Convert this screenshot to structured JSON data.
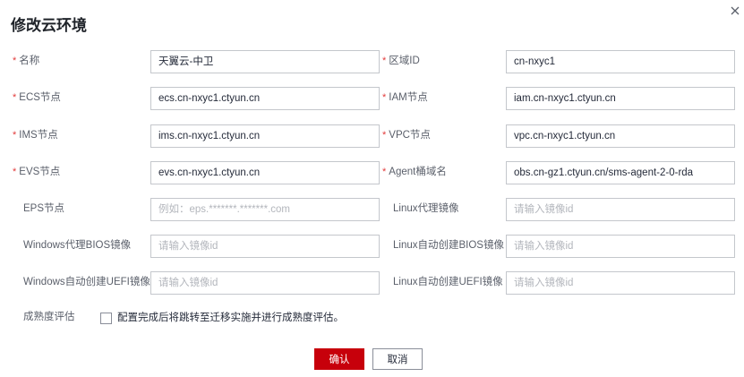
{
  "dialog": {
    "title": "修改云环境",
    "close_icon": "close-icon"
  },
  "form": {
    "required_mark": "*",
    "fields": {
      "name": {
        "label": "名称",
        "value": "天翼云-中卫",
        "required": true
      },
      "region_id": {
        "label": "区域ID",
        "value": "cn-nxyc1",
        "required": true
      },
      "ecs": {
        "label": "ECS节点",
        "value": "ecs.cn-nxyc1.ctyun.cn",
        "required": true
      },
      "iam": {
        "label": "IAM节点",
        "value": "iam.cn-nxyc1.ctyun.cn",
        "required": true
      },
      "ims": {
        "label": "IMS节点",
        "value": "ims.cn-nxyc1.ctyun.cn",
        "required": true
      },
      "vpc": {
        "label": "VPC节点",
        "value": "vpc.cn-nxyc1.ctyun.cn",
        "required": true
      },
      "evs": {
        "label": "EVS节点",
        "value": "evs.cn-nxyc1.ctyun.cn",
        "required": true
      },
      "agent_bucket": {
        "label": "Agent桶域名",
        "value": "obs.cn-gz1.ctyun.cn/sms-agent-2-0-rda",
        "required": true
      },
      "eps": {
        "label": "EPS节点",
        "placeholder": "例如：eps.*******.*******.com",
        "required": false
      },
      "linux_proxy_image": {
        "label": "Linux代理镜像",
        "placeholder": "请输入镜像id",
        "required": false
      },
      "windows_proxy_bios_image": {
        "label": "Windows代理BIOS镜像",
        "placeholder": "请输入镜像id",
        "required": false
      },
      "linux_auto_bios_image": {
        "label": "Linux自动创建BIOS镜像",
        "placeholder": "请输入镜像id",
        "required": false
      },
      "windows_auto_uefi_image": {
        "label": "Windows自动创建UEFI镜像",
        "placeholder": "请输入镜像id",
        "required": false
      },
      "linux_auto_uefi_image": {
        "label": "Linux自动创建UEFI镜像",
        "placeholder": "请输入镜像id",
        "required": false
      }
    },
    "maturity": {
      "label": "成熟度评估",
      "checkbox_text": "配置完成后将跳转至迁移实施并进行成熟度评估。",
      "checked": false
    }
  },
  "buttons": {
    "confirm": "确认",
    "cancel": "取消"
  },
  "colors": {
    "required": "#e23a3a",
    "primary": "#c7000b",
    "border": "#c4c7cc"
  }
}
